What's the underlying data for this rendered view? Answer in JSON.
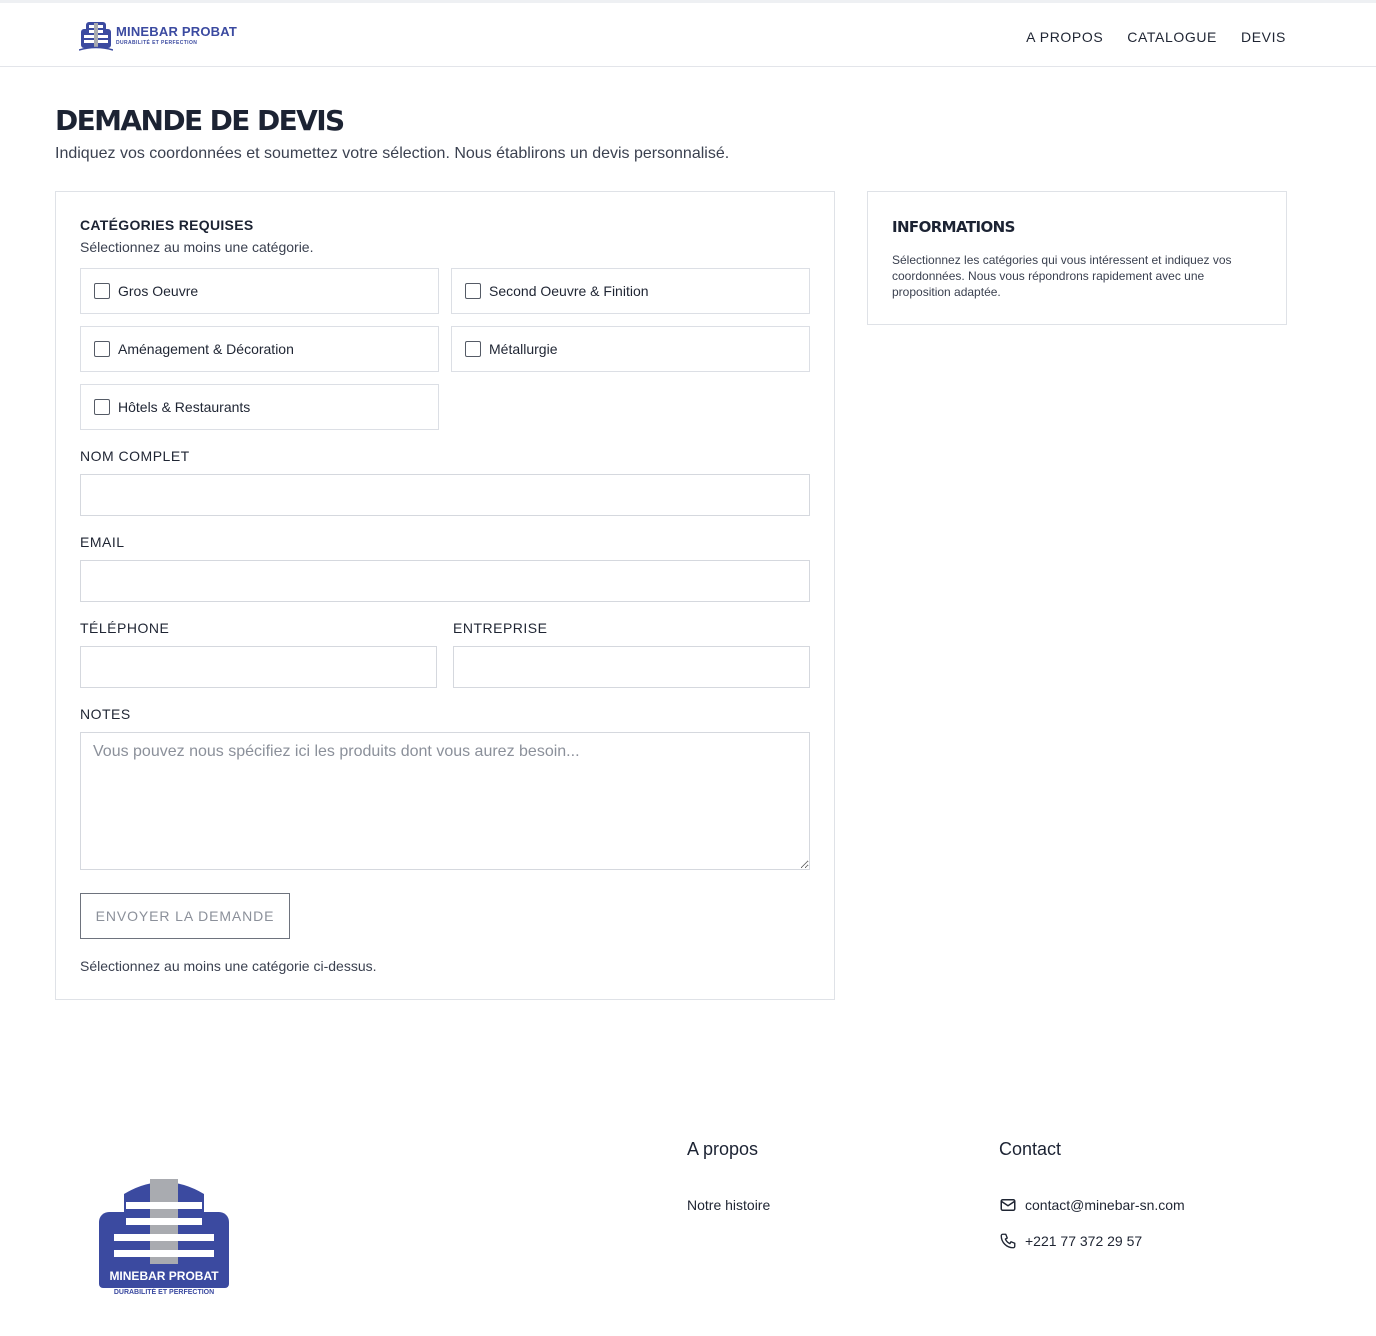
{
  "brand": {
    "name": "MINEBAR PROBAT",
    "tagline": "DURABILITÉ ET PERFECTION",
    "primary_color": "#3b4aa0",
    "secondary_color": "#a9abb0"
  },
  "nav": {
    "items": [
      {
        "label": "A PROPOS"
      },
      {
        "label": "CATALOGUE"
      },
      {
        "label": "DEVIS"
      }
    ]
  },
  "page": {
    "title": "DEMANDE DE DEVIS",
    "subtitle": "Indiquez vos coordonnées et soumettez votre sélection. Nous établirons un devis personnalisé."
  },
  "form": {
    "categories_title": "CATÉGORIES REQUISES",
    "categories_sub": "Sélectionnez au moins une catégorie.",
    "categories": [
      {
        "label": "Gros Oeuvre",
        "checked": false
      },
      {
        "label": "Second Oeuvre & Finition",
        "checked": false
      },
      {
        "label": "Aménagement & Décoration",
        "checked": false
      },
      {
        "label": "Métallurgie",
        "checked": false
      },
      {
        "label": "Hôtels & Restaurants",
        "checked": false
      }
    ],
    "fields": {
      "name_label": "NOM COMPLET",
      "name_value": "",
      "email_label": "EMAIL",
      "email_value": "",
      "phone_label": "TÉLÉPHONE",
      "phone_value": "",
      "company_label": "ENTREPRISE",
      "company_value": "",
      "notes_label": "NOTES",
      "notes_placeholder": "Vous pouvez nous spécifiez ici les produits dont vous aurez besoin..."
    },
    "submit_label": "ENVOYER LA DEMANDE",
    "hint": "Sélectionnez au moins une catégorie ci-dessus."
  },
  "info": {
    "title": "INFORMATIONS",
    "text": "Sélectionnez les catégories qui vous intéressent et indiquez vos coordonnées. Nous vous répondrons rapidement avec une proposition adaptée."
  },
  "footer": {
    "about_title": "A propos",
    "about_links": [
      {
        "label": "Notre histoire"
      }
    ],
    "contact_title": "Contact",
    "email": "contact@minebar-sn.com",
    "phone": "+221 77 372 29 57",
    "email_icon": "mail-icon",
    "phone_icon": "phone-icon"
  }
}
